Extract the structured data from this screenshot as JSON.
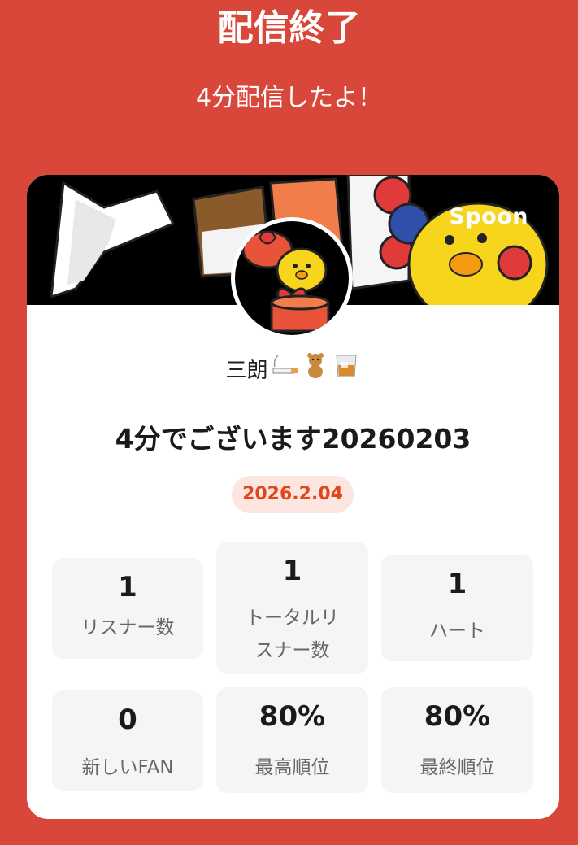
{
  "header": {
    "title": "配信終了",
    "subtitle": "4分配信したよ！"
  },
  "card": {
    "brand": "Spoon",
    "username": "三朗",
    "username_emojis": [
      "cigarette-icon",
      "teddy-bear-icon",
      "whiskey-glass-icon"
    ],
    "broadcast_title": "4分でございます20260203",
    "date": "2026.2.04",
    "stats": [
      {
        "value": "1",
        "label": "リスナー数"
      },
      {
        "value": "1",
        "label": "トータルリスナー数",
        "label_line1": "トータルリ",
        "label_line2": "スナー数"
      },
      {
        "value": "1",
        "label": "ハート"
      },
      {
        "value": "0",
        "label": "新しいFAN"
      },
      {
        "value": "80%",
        "label": "最高順位"
      },
      {
        "value": "80%",
        "label": "最終順位"
      }
    ]
  },
  "colors": {
    "background": "#D9473A",
    "card": "#FFFFFF",
    "date_pill_bg": "#FCE6DF",
    "date_pill_text": "#E0471D",
    "stat_bg": "#F5F5F5"
  }
}
